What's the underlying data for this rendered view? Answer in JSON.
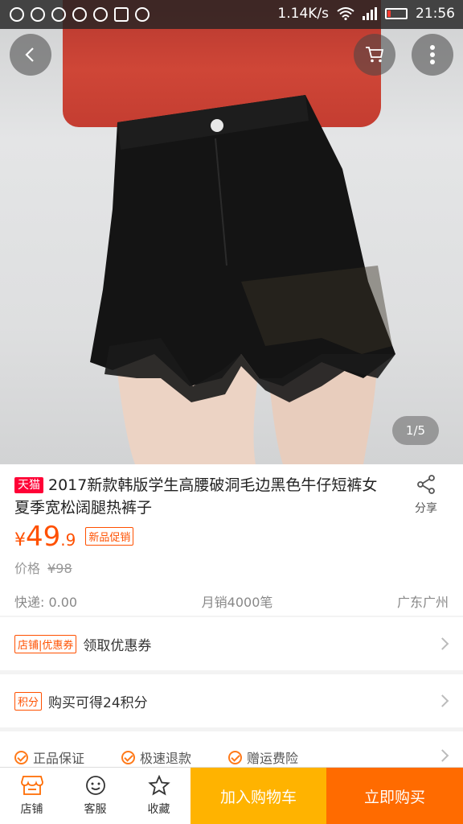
{
  "status_bar": {
    "speed": "1.14K/s",
    "time": "21:56"
  },
  "header_icons": {
    "back": "chevron-left-icon",
    "cart": "cart-icon",
    "more": "more-vertical-icon"
  },
  "gallery": {
    "pager": "1/5"
  },
  "product": {
    "tag": "天猫",
    "title": "2017新款韩版学生高腰破洞毛边黑色牛仔短裤女夏季宽松阔腿热裤子",
    "share_label": "分享",
    "currency": "¥",
    "price_int": "49",
    "price_dec": ".9",
    "promo_tag": "新品促销",
    "orig_label": "价格",
    "orig_price": "¥98",
    "shipping": "快递: 0.00",
    "monthly_sales": "月销4000笔",
    "location": "广东广州",
    "accent_color": "#ff5000"
  },
  "coupon_row": {
    "tag": "店铺|优惠券",
    "text": "领取优惠券"
  },
  "points_row": {
    "tag": "积分",
    "text": "购买可得24积分"
  },
  "guarantees": [
    {
      "label": "正品保证"
    },
    {
      "label": "极速退款"
    },
    {
      "label": "赠运费险"
    }
  ],
  "bottom_bar": {
    "shop": "店铺",
    "service": "客服",
    "favorite": "收藏",
    "add_to_cart": "加入购物车",
    "buy_now": "立即购买",
    "cart_color": "#ffb300",
    "buy_color": "#ff6b00"
  }
}
